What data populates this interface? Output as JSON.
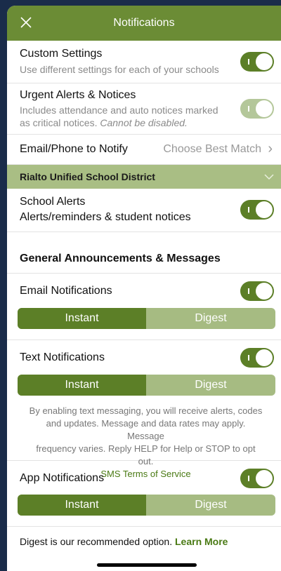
{
  "header": {
    "title": "Notifications"
  },
  "custom": {
    "title": "Custom Settings",
    "sub": "Use different settings for each of your schools"
  },
  "urgent": {
    "title": "Urgent Alerts & Notices",
    "sub1": "Includes attendance and auto notices marked",
    "sub2": "as critical notices.",
    "sub_italic": "Cannot be disabled."
  },
  "email_phone": {
    "label": "Email/Phone to Notify",
    "value": "Choose Best Match",
    "chevron": "›"
  },
  "district": {
    "name": "Rialto Unified School District"
  },
  "school_alerts": {
    "title": "School Alerts",
    "sub": "Alerts/reminders & student notices"
  },
  "section": {
    "title": "General Announcements & Messages"
  },
  "email_notif": {
    "title": "Email Notifications",
    "instant": "Instant",
    "digest": "Digest"
  },
  "text_notif": {
    "title": "Text Notifications",
    "instant": "Instant",
    "digest": "Digest"
  },
  "disclaimer": {
    "line1": "By enabling text messaging, you will receive alerts, codes",
    "line2": "and updates. Message and data rates may apply. Message",
    "line3": "frequency varies. Reply HELP for Help or STOP to opt out.",
    "link": "SMS Terms of Service"
  },
  "app_notif": {
    "title": "App Notifications",
    "instant": "Instant",
    "digest": "Digest"
  },
  "footer": {
    "text": "Digest is our recommended option.",
    "link": "Learn More"
  },
  "toggle_glyph": "I"
}
